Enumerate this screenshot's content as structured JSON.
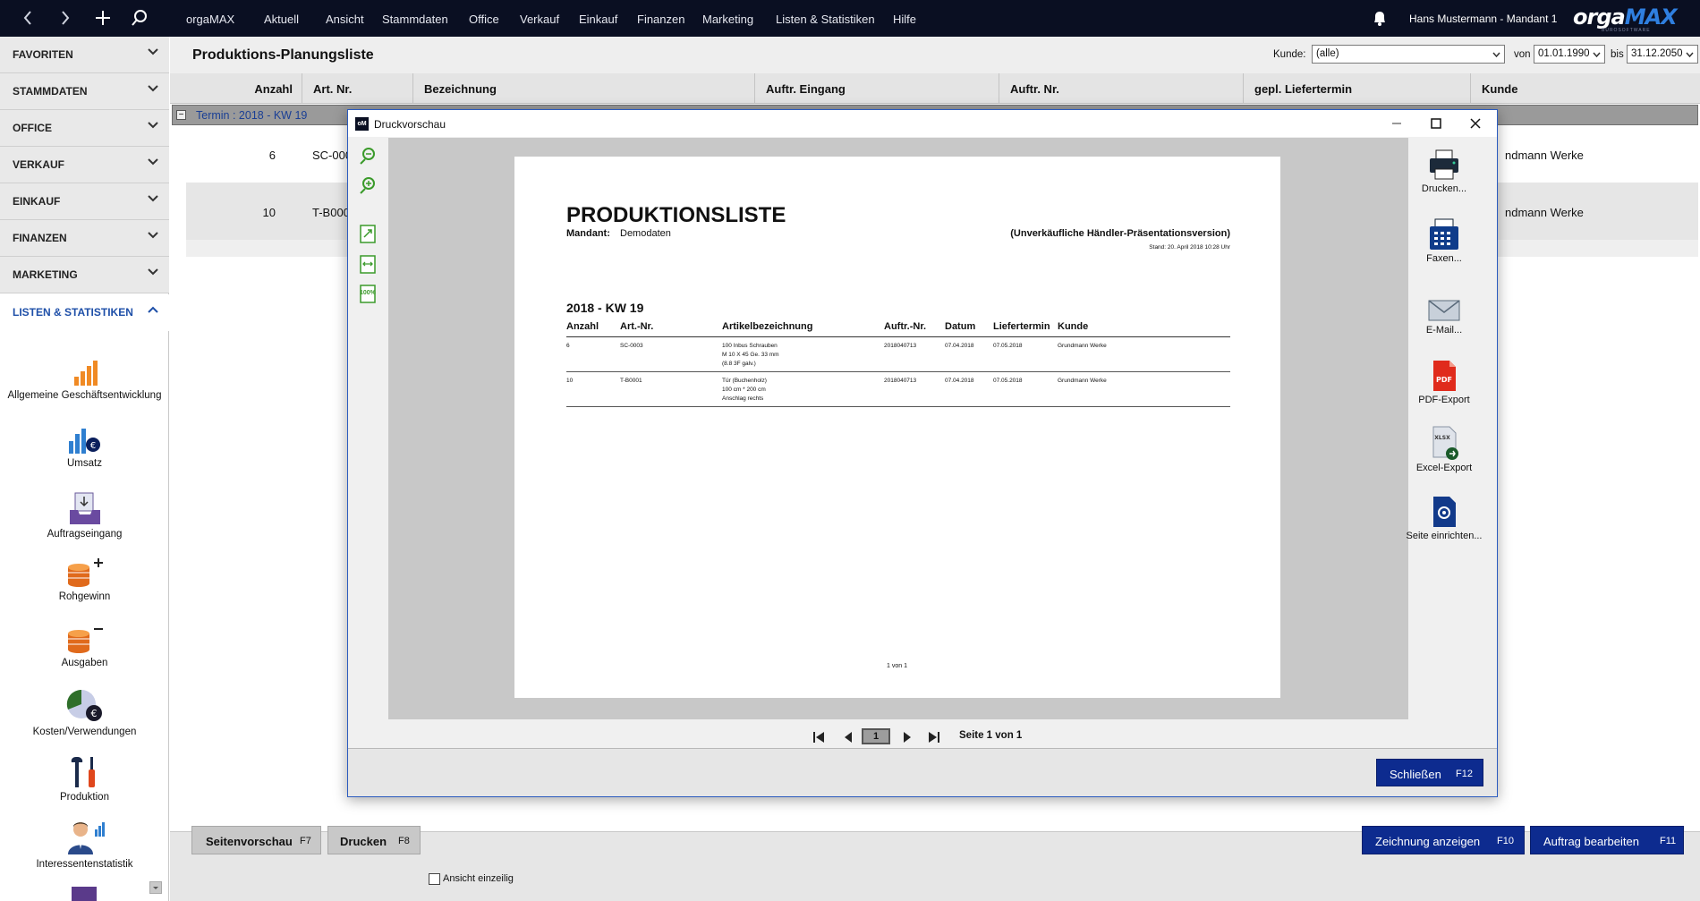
{
  "topbar": {
    "menu": [
      "orgaMAX",
      "Aktuell",
      "Ansicht",
      "Stammdaten",
      "Office",
      "Verkauf",
      "Einkauf",
      "Finanzen",
      "Marketing",
      "Listen & Statistiken",
      "Hilfe"
    ],
    "user": "Hans Mustermann - Mandant 1",
    "logo_a": "orga",
    "logo_b": "MAX",
    "logo_sub": "BUROSOFTWARE"
  },
  "sidebar": {
    "sections": [
      "FAVORITEN",
      "STAMMDATEN",
      "OFFICE",
      "VERKAUF",
      "EINKAUF",
      "FINANZEN",
      "MARKETING",
      "LISTEN & STATISTIKEN"
    ],
    "items": [
      "Allgemeine Geschäftsentwicklung",
      "Umsatz",
      "Auftragseingang",
      "Rohgewinn",
      "Ausgaben",
      "Kosten/Verwendungen",
      "Produktion",
      "Interessentenstatistik"
    ]
  },
  "main": {
    "title": "Produktions-Planungsliste",
    "filter": {
      "kunde_label": "Kunde:",
      "kunde_value": "(alle)",
      "von_label": "von",
      "von_value": "01.01.1990",
      "bis_label": "bis",
      "bis_value": "31.12.2050"
    },
    "columns": [
      "Anzahl",
      "Art. Nr.",
      "Bezeichnung",
      "Auftr. Eingang",
      "Auftr. Nr.",
      "gepl. Liefertermin",
      "Kunde"
    ],
    "group_label": "Termin : 2018 - KW 19",
    "rows": [
      {
        "anzahl": "6",
        "art": "SC-000",
        "kunde": "ndmann Werke"
      },
      {
        "anzahl": "10",
        "art": "T-B000",
        "kunde": "ndmann Werke"
      }
    ]
  },
  "bottombar": {
    "seitenvorschau": "Seitenvorschau",
    "seitenvorschau_key": "F7",
    "drucken": "Drucken",
    "drucken_key": "F8",
    "ansicht_einzeilig": "Ansicht einzeilig",
    "zeichnung": "Zeichnung anzeigen",
    "zeichnung_key": "F10",
    "auftrag": "Auftrag bearbeiten",
    "auftrag_key": "F11"
  },
  "preview": {
    "window_title": "Druckvorschau",
    "app_icon": "oM",
    "doc": {
      "title": "PRODUKTIONSLISTE",
      "mandant_label": "Mandant:",
      "mandant_value": "Demodaten",
      "subtitle": "(Unverkäufliche Händler-Präsentationsversion)",
      "stand": "Stand:  20. April 2018 10:28 Uhr",
      "section": "2018 - KW 19",
      "columns": [
        "Anzahl",
        "Art.-Nr.",
        "Artikelbezeichnung",
        "Auftr.-Nr.",
        "Datum",
        "Liefertermin",
        "Kunde"
      ],
      "rows": [
        {
          "anzahl": "6",
          "art": "SC-0003",
          "bez1": "100 Inbus Schrauben",
          "bez2": "M 10 X 45 Ge. 33 mm",
          "bez3": "(8.8 3F galv.)",
          "auftr": "2018040713",
          "datum": "07.04.2018",
          "liefer": "07.05.2018",
          "kunde": "Grundmann Werke"
        },
        {
          "anzahl": "10",
          "art": "T-B0001",
          "bez1": "Tür (Buchenholz)",
          "bez2": "100 cm * 200 cm",
          "bez3": "Anschlag rechts",
          "auftr": "2018040713",
          "datum": "07.04.2018",
          "liefer": "07.05.2018",
          "kunde": "Grundmann Werke"
        }
      ],
      "footer": "1 von 1"
    },
    "actions": [
      "Drucken...",
      "Faxen...",
      "E-Mail...",
      "PDF-Export",
      "Excel-Export",
      "Seite einrichten..."
    ],
    "pdf_icon_text": "PDF",
    "xlsx_icon_text": "XLSX",
    "zoom_label": "100%",
    "page_number": "1",
    "page_info": "Seite 1 von 1",
    "close_label": "Schließen",
    "close_key": "F12"
  },
  "colors": {
    "topbar": "#0a0f22",
    "accent": "#0d2b8f",
    "active_section": "#1e4fa8",
    "green_tools": "#3a9a2a"
  }
}
